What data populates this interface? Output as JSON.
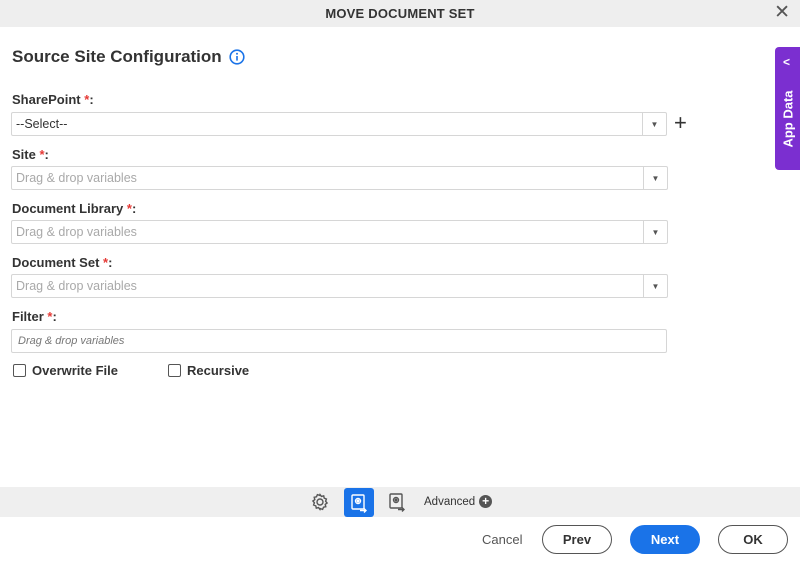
{
  "window": {
    "title": "MOVE DOCUMENT SET",
    "close_symbol": "✕"
  },
  "section": {
    "title": "Source Site Configuration"
  },
  "required_mark": "*",
  "fields": {
    "sharepoint": {
      "label": "SharePoint",
      "value": "--Select--"
    },
    "site": {
      "label": "Site",
      "placeholder": "Drag & drop variables"
    },
    "document_library": {
      "label": "Document Library",
      "placeholder": "Drag & drop variables"
    },
    "document_set": {
      "label": "Document Set",
      "placeholder": "Drag & drop variables"
    },
    "filter": {
      "label": "Filter",
      "placeholder": "Drag & drop variables"
    }
  },
  "checkboxes": {
    "overwrite_file": {
      "label": "Overwrite File",
      "checked": false
    },
    "recursive": {
      "label": "Recursive",
      "checked": false
    }
  },
  "side_panel": {
    "label": "App Data"
  },
  "toolbar": {
    "advanced_label": "Advanced"
  },
  "footer": {
    "cancel": "Cancel",
    "prev": "Prev",
    "next": "Next",
    "ok": "OK"
  },
  "colors": {
    "accent": "#1a73e8",
    "side_panel": "#7b2fd0",
    "required": "#e53935"
  },
  "icons": [
    "close-icon",
    "info-icon",
    "chevron-down-icon",
    "plus-icon",
    "chevron-left-icon",
    "gear-icon",
    "source-config-icon",
    "destination-config-icon",
    "plus-circle-icon"
  ]
}
